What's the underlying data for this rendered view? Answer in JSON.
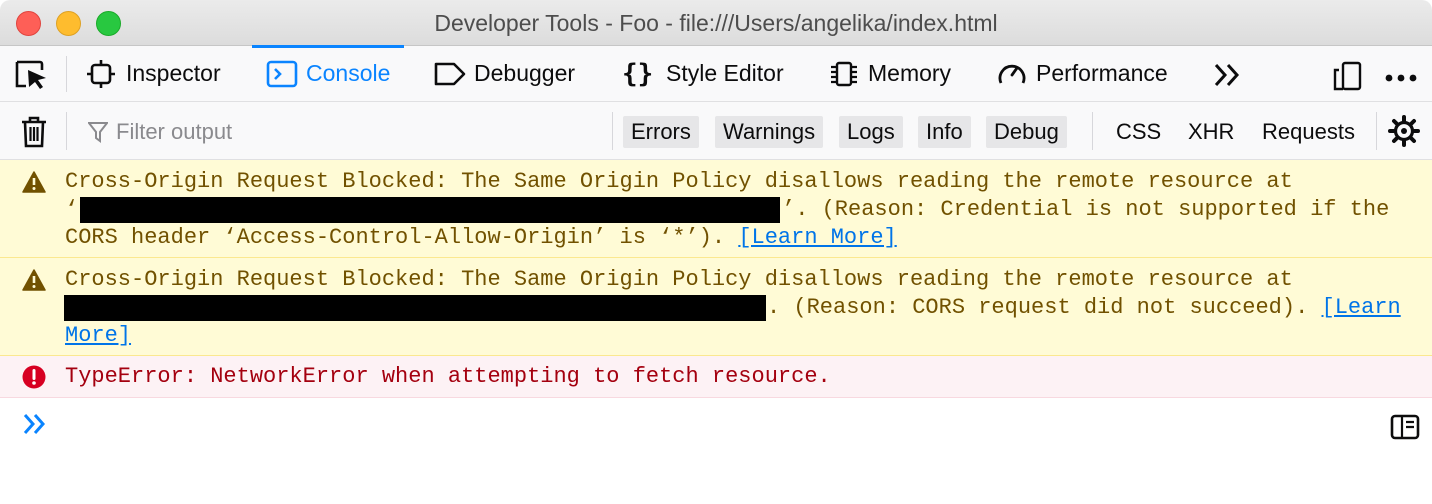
{
  "window": {
    "title": "Developer Tools - Foo - file:///Users/angelika/index.html"
  },
  "tabs": [
    {
      "label": "Inspector",
      "icon": "inspector-icon"
    },
    {
      "label": "Console",
      "icon": "console-icon",
      "selected": true
    },
    {
      "label": "Debugger",
      "icon": "debugger-icon"
    },
    {
      "label": "Style Editor",
      "icon": "style-editor-icon"
    },
    {
      "label": "Memory",
      "icon": "memory-icon"
    },
    {
      "label": "Performance",
      "icon": "performance-icon"
    }
  ],
  "toolbar": {
    "filter_placeholder": "Filter output",
    "levels": [
      "Errors",
      "Warnings",
      "Logs",
      "Info",
      "Debug"
    ],
    "net_filters": [
      "CSS",
      "XHR",
      "Requests"
    ]
  },
  "messages": {
    "warn1": {
      "line1": "Cross-Origin Request Blocked: The Same Origin Policy disallows reading the remote resource at",
      "line2_open": "‘",
      "line2_rest": "’. (Reason: Credential is not supported if the",
      "line3": "CORS header ‘Access-Control-Allow-Origin’ is ‘*’). ",
      "link": "[Learn More]"
    },
    "warn2": {
      "line1": "Cross-Origin Request Blocked: The Same Origin Policy disallows reading the remote resource at",
      "line2_rest": ". (Reason: CORS request did not succeed). ",
      "link_a": "[Learn",
      "link_b": "More]"
    },
    "error": {
      "text": "TypeError: NetworkError when attempting to fetch resource."
    }
  },
  "colors": {
    "accent": "#0a84ff",
    "warning_bg": "#fffbd6",
    "warning_text": "#715100",
    "error_bg": "#fdf2f5",
    "error_text": "#a4000f",
    "link": "#0074e8"
  }
}
